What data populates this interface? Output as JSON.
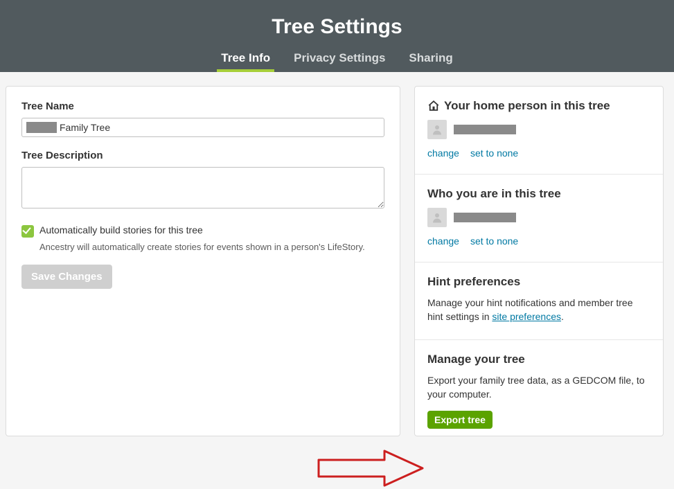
{
  "header": {
    "title": "Tree Settings",
    "tabs": [
      {
        "label": "Tree Info",
        "active": true
      },
      {
        "label": "Privacy Settings",
        "active": false
      },
      {
        "label": "Sharing",
        "active": false
      }
    ]
  },
  "left_panel": {
    "tree_name_label": "Tree Name",
    "tree_name_value_suffix": "Family Tree",
    "tree_desc_label": "Tree Description",
    "tree_desc_value": "",
    "checkbox_label": "Automatically build stories for this tree",
    "checkbox_desc": "Ancestry will automatically create stories for events shown in a person's LifeStory.",
    "save_button": "Save Changes"
  },
  "right_panel": {
    "home_person": {
      "title": "Your home person in this tree",
      "change_link": "change",
      "set_none_link": "set to none"
    },
    "who_you_are": {
      "title": "Who you are in this tree",
      "change_link": "change",
      "set_none_link": "set to none"
    },
    "hint_prefs": {
      "title": "Hint preferences",
      "desc_prefix": "Manage your hint notifications and member tree hint settings in ",
      "link_text": "site preferences",
      "desc_suffix": "."
    },
    "manage_tree": {
      "title": "Manage your tree",
      "desc": "Export your family tree data, as a GEDCOM file, to your computer.",
      "export_button": "Export tree"
    }
  }
}
